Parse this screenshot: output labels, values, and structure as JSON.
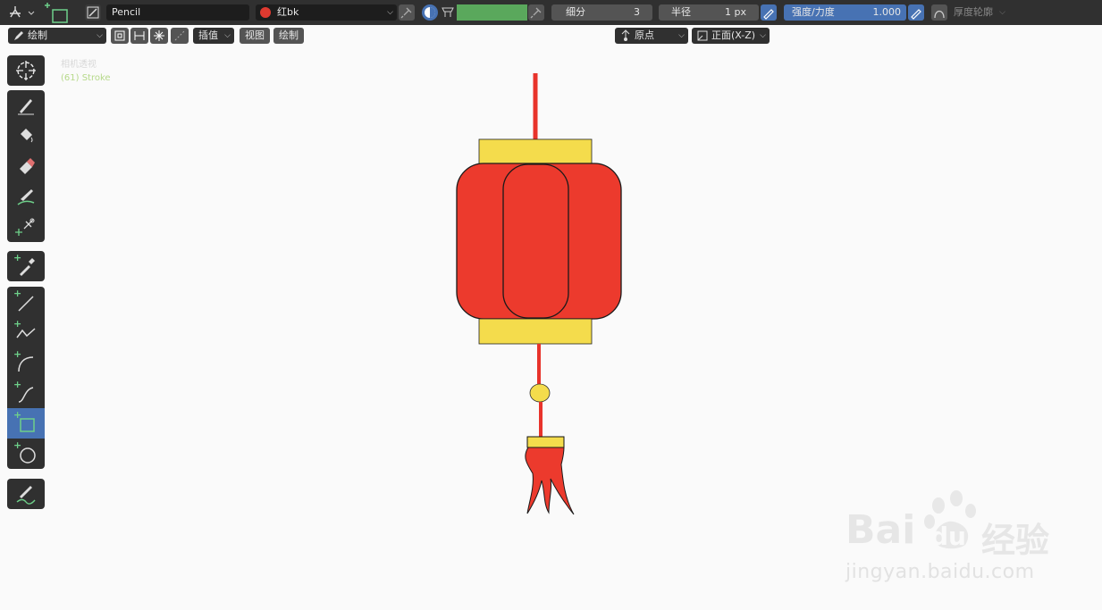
{
  "header": {
    "brush_name": "Pencil",
    "material_name": "红bk",
    "material_color": "#e03a30",
    "subdivide_label": "细分",
    "subdivide_value": "3",
    "radius_label": "半径",
    "radius_value": "1 px",
    "strength_label": "强度/力度",
    "strength_value": "1.000",
    "thickness_label": "厚度轮廓",
    "color_swatch": "#5aa85c"
  },
  "subheader": {
    "mode_label": "绘制",
    "interp_label": "插值",
    "view_label": "视图",
    "draw_label": "绘制",
    "pivot_label": "原点",
    "orientation_label": "正面(X-Z)"
  },
  "viewport": {
    "camera_text": "相机透视",
    "object_text": "(61) Stroke"
  },
  "watermark": {
    "brand": "Bai",
    "brand_tail": "du",
    "site_cn": "经验",
    "url": "jingyan.baidu.com"
  },
  "colors": {
    "lantern_red": "#e8332b",
    "lantern_yellow": "#f4dc4c",
    "ui_dark": "#303030",
    "active_blue": "#4772b3"
  }
}
